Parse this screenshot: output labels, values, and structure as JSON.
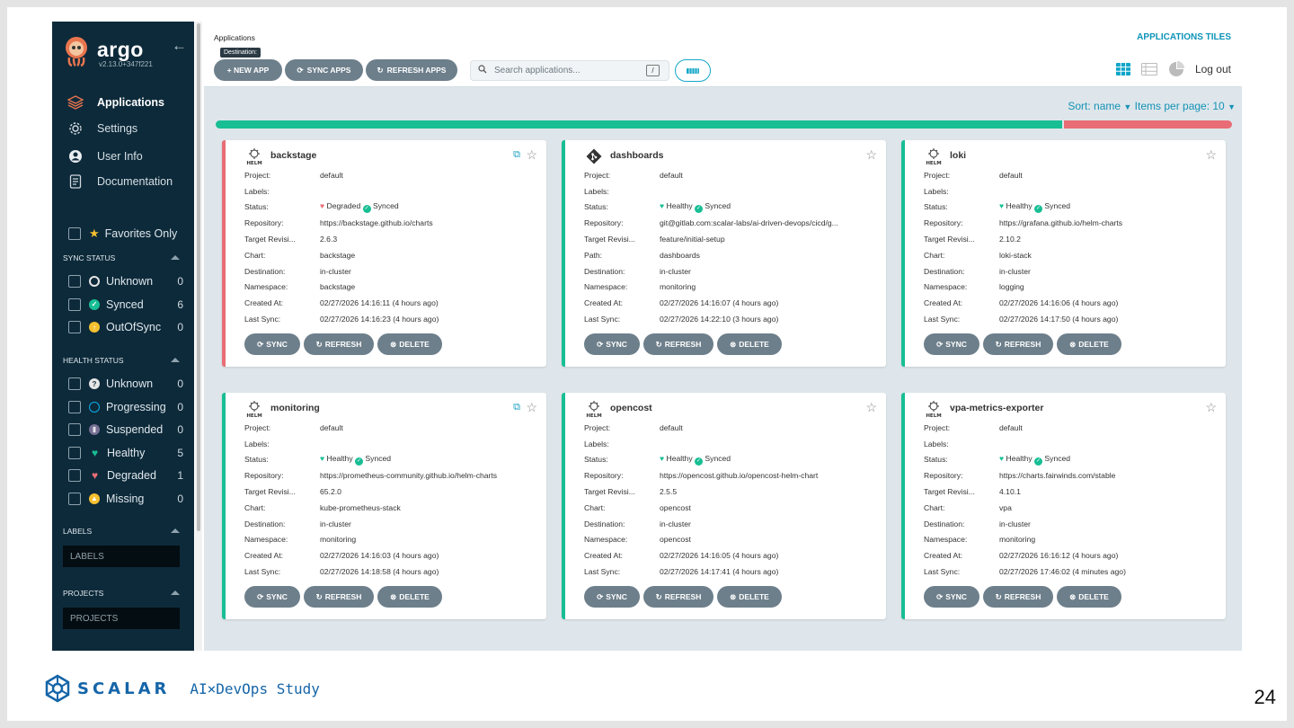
{
  "brand": {
    "name": "argo",
    "version": "v2.13.0+347f221"
  },
  "nav": [
    {
      "label": "Applications",
      "icon": "stack-icon"
    },
    {
      "label": "Settings",
      "icon": "gear-icon"
    },
    {
      "label": "User Info",
      "icon": "user-icon"
    },
    {
      "label": "Documentation",
      "icon": "doc-icon"
    }
  ],
  "filters": {
    "favorites": "Favorites Only",
    "sync_title": "SYNC STATUS",
    "sync": [
      {
        "label": "Unknown",
        "count": "0",
        "color": "#e6e6e6"
      },
      {
        "label": "Synced",
        "count": "6",
        "color": "#18be94"
      },
      {
        "label": "OutOfSync",
        "count": "0",
        "color": "#f4c030"
      }
    ],
    "health_title": "HEALTH STATUS",
    "health": [
      {
        "label": "Unknown",
        "count": "0",
        "color": "#e6e6e6"
      },
      {
        "label": "Progressing",
        "count": "0",
        "color": "#0dadea"
      },
      {
        "label": "Suspended",
        "count": "0",
        "color": "#766f94"
      },
      {
        "label": "Healthy",
        "count": "5",
        "color": "#18be94"
      },
      {
        "label": "Degraded",
        "count": "1",
        "color": "#e96d76"
      },
      {
        "label": "Missing",
        "count": "0",
        "color": "#f4c030"
      }
    ],
    "labels_title": "LABELS",
    "labels_placeholder": "LABELS",
    "projects_title": "PROJECTS",
    "projects_placeholder": "PROJECTS"
  },
  "header": {
    "breadcrumb": "Applications",
    "tiles_title": "APPLICATIONS TILES",
    "tooltip": "Destination:",
    "new_app": "+ NEW APP",
    "sync_apps": "SYNC APPS",
    "refresh_apps": "REFRESH APPS",
    "search_placeholder": "Search applications...",
    "search_shortcut": "/",
    "logout": "Log out",
    "sort_name": "Sort: name",
    "items_per_page": "Items per page: 10"
  },
  "status_bar": {
    "healthy_fraction": 0.833,
    "degraded_fraction": 0.167,
    "healthy_color": "#18be94",
    "degraded_color": "#e96d76"
  },
  "labels": {
    "project": "Project:",
    "labels": "Labels:",
    "status": "Status:",
    "repository": "Repository:",
    "target": "Target Revisi...",
    "chart": "Chart:",
    "path": "Path:",
    "destination": "Destination:",
    "namespace": "Namespace:",
    "created": "Created At:",
    "last_sync": "Last Sync:",
    "sync_btn": "SYNC",
    "refresh_btn": "REFRESH",
    "delete_btn": "DELETE"
  },
  "apps": [
    {
      "name": "backstage",
      "project": "default",
      "health": "Degraded",
      "sync": "Synced",
      "repo": "https://backstage.github.io/charts",
      "target": "2.6.3",
      "chart": "backstage",
      "destination": "in-cluster",
      "namespace": "backstage",
      "created": "02/27/2026 14:16:11  (4 hours ago)",
      "last_sync": "02/27/2026 14:16:23  (4 hours ago)"
    },
    {
      "name": "dashboards",
      "project": "default",
      "health": "Healthy",
      "sync": "Synced",
      "repo": "git@gitlab.com:scalar-labs/ai-driven-devops/cicd/g...",
      "target": "feature/initial-setup",
      "path": "dashboards",
      "destination": "in-cluster",
      "namespace": "monitoring",
      "created": "02/27/2026 14:16:07  (4 hours ago)",
      "last_sync": "02/27/2026 14:22:10  (3 hours ago)"
    },
    {
      "name": "loki",
      "project": "default",
      "health": "Healthy",
      "sync": "Synced",
      "repo": "https://grafana.github.io/helm-charts",
      "target": "2.10.2",
      "chart": "loki-stack",
      "destination": "in-cluster",
      "namespace": "logging",
      "created": "02/27/2026 14:16:06  (4 hours ago)",
      "last_sync": "02/27/2026 14:17:50  (4 hours ago)"
    },
    {
      "name": "monitoring",
      "project": "default",
      "health": "Healthy",
      "sync": "Synced",
      "repo": "https://prometheus-community.github.io/helm-charts",
      "target": "65.2.0",
      "chart": "kube-prometheus-stack",
      "destination": "in-cluster",
      "namespace": "monitoring",
      "created": "02/27/2026 14:16:03  (4 hours ago)",
      "last_sync": "02/27/2026 14:18:58  (4 hours ago)"
    },
    {
      "name": "opencost",
      "project": "default",
      "health": "Healthy",
      "sync": "Synced",
      "repo": "https://opencost.github.io/opencost-helm-chart",
      "target": "2.5.5",
      "chart": "opencost",
      "destination": "in-cluster",
      "namespace": "opencost",
      "created": "02/27/2026 14:16:05  (4 hours ago)",
      "last_sync": "02/27/2026 14:17:41  (4 hours ago)"
    },
    {
      "name": "vpa-metrics-exporter",
      "project": "default",
      "health": "Healthy",
      "sync": "Synced",
      "repo": "https://charts.fairwinds.com/stable",
      "target": "4.10.1",
      "chart": "vpa",
      "destination": "in-cluster",
      "namespace": "monitoring",
      "created": "02/27/2026 16:16:12  (4 hours ago)",
      "last_sync": "02/27/2026 17:46:02  (4 minutes ago)"
    }
  ],
  "footer": {
    "company": "SCALAR",
    "tagline": "AI×DevOps Study",
    "page": "24"
  }
}
